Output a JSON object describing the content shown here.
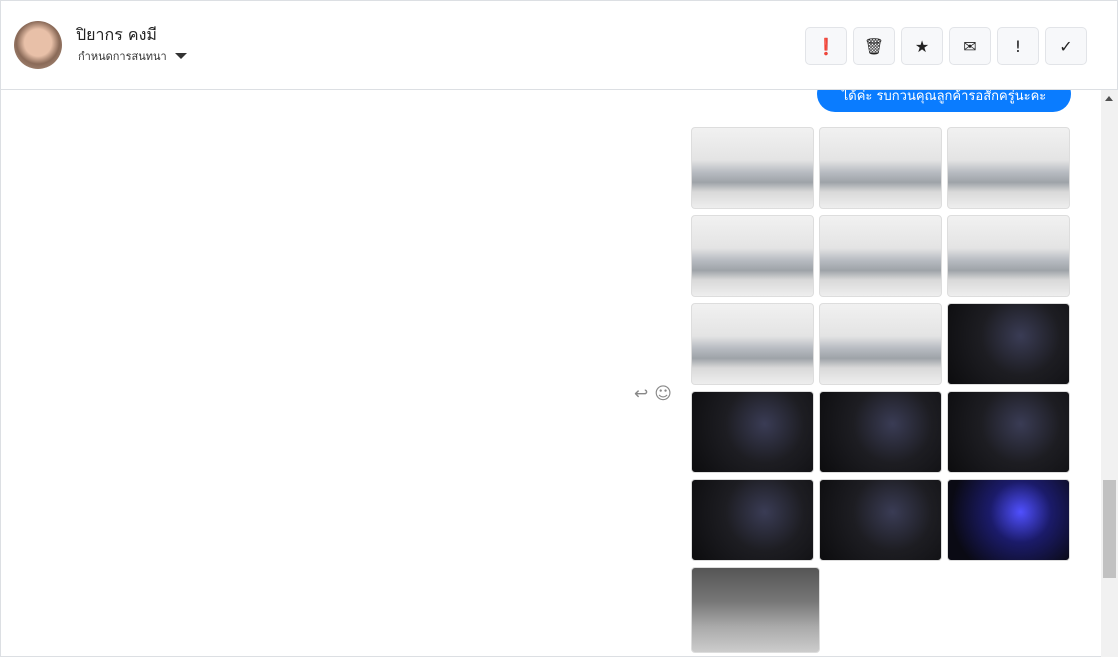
{
  "header": {
    "contact_name": "ปิยากร คงมี",
    "subtitle": "กำหนดการสนทนา",
    "tools": [
      {
        "icon": "alert-circle-icon",
        "glyph": "❗"
      },
      {
        "icon": "trash-icon",
        "glyph": "🗑"
      },
      {
        "icon": "star-icon",
        "glyph": "★"
      },
      {
        "icon": "envelope-icon",
        "glyph": "✉"
      },
      {
        "icon": "exclamation-icon",
        "glyph": "!"
      },
      {
        "icon": "check-icon",
        "glyph": "✓"
      }
    ]
  },
  "chat": {
    "bubble_text": "ได้ค่ะ รบกวนคุณลูกค้ารอสักครู่นะคะ",
    "bubble_color": "#0a7cff",
    "actions": {
      "reply_glyph": "↩",
      "react_glyph": "☺"
    },
    "images": [
      "exterior-front-left",
      "exterior-front",
      "exterior-front-right",
      "exterior-rear-left",
      "exterior-rear",
      "exterior-rear-right",
      "exterior-side-left",
      "exterior-side-right",
      "interior-dashboard",
      "interior-front-seats",
      "interior-gear",
      "interior-rear-seats",
      "interior-console",
      "interior-door",
      "instrument-cluster",
      "engine-bay"
    ]
  }
}
